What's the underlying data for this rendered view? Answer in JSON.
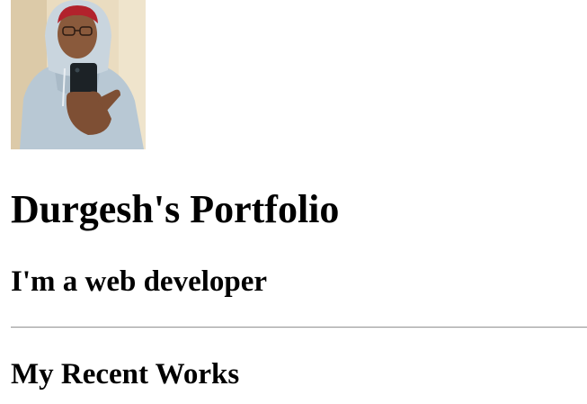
{
  "profile": {
    "photo_alt": "profile-photo",
    "title": "Durgesh's Portfolio",
    "tagline": "I'm a web developer"
  },
  "sections": {
    "recent_works_heading": "My Recent Works"
  },
  "colors": {
    "background": "#ffffff",
    "text": "#000000",
    "divider": "#9a9a9a"
  }
}
